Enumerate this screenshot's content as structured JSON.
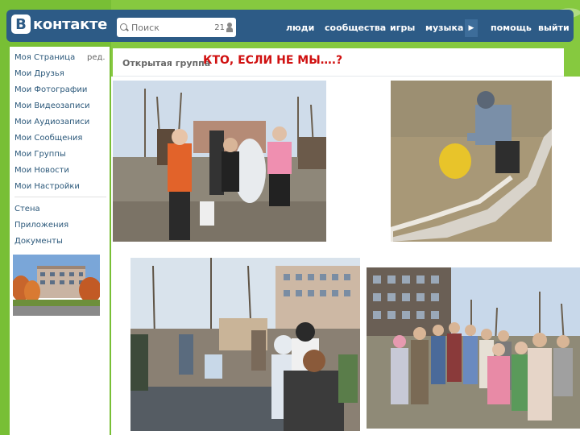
{
  "logo": {
    "badge": "В",
    "text": "контакте"
  },
  "search": {
    "placeholder": "Поиск",
    "count": "21"
  },
  "nav": {
    "items": [
      "люди",
      "сообщества",
      "игры",
      "музыка",
      "помощь",
      "выйти"
    ]
  },
  "sidebar": {
    "edit_label": "ред.",
    "items": [
      "Моя Страница",
      "Мои Друзья",
      "Мои Фотографии",
      "Мои Видеозаписи",
      "Мои Аудиозаписи",
      "Мои Сообщения",
      "Мои Группы",
      "Мои Новости",
      "Мои Настройки"
    ],
    "extra_items": [
      "Стена",
      "Приложения",
      "Документы"
    ]
  },
  "group": {
    "label": "Открытая группа",
    "name": "КТО, ЕСЛИ НЕ МЫ….?"
  },
  "colors": {
    "topbar": "#2d5b86",
    "background_green": "#7fc43a",
    "link": "#2b587a",
    "group_title": "#d01010"
  }
}
